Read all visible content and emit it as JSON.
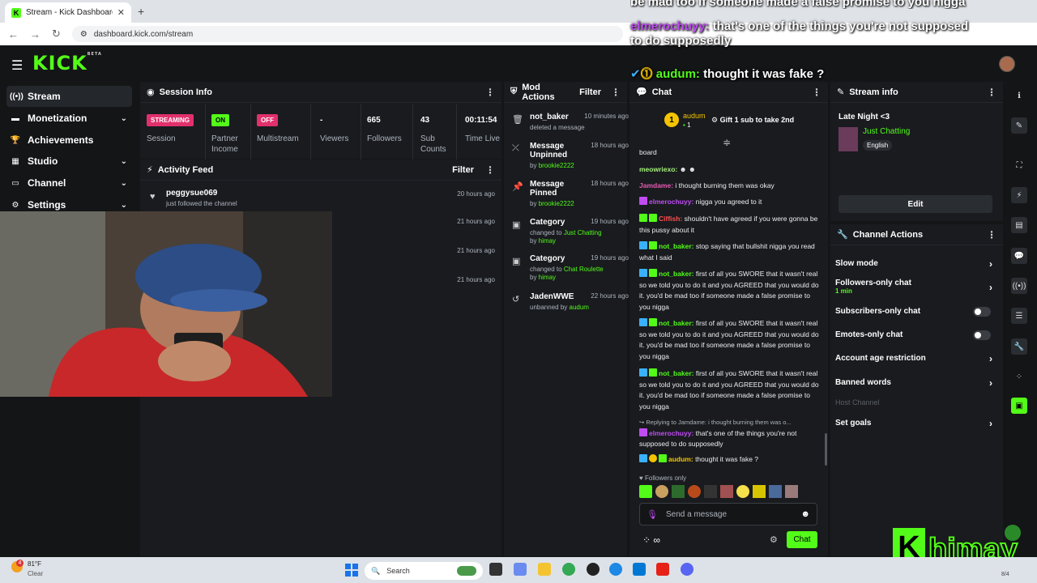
{
  "browser": {
    "tab_title": "Stream - Kick Dashboard",
    "url": "dashboard.kick.com/stream"
  },
  "overlay": {
    "top_text": "be mad too if someone made a false promise to you nigga",
    "msg1_user": "elmerochuyy:",
    "msg1_text": "that's one of the things you're not supposed",
    "msg1_text2": "to do supposedly",
    "msg2_user": "audum:",
    "msg2_text": "thought it was fake ?"
  },
  "app": {
    "logo": "KICK",
    "logo_sup": "BETA"
  },
  "sidebar": {
    "items": [
      {
        "label": "Stream",
        "icon": "stream-icon"
      },
      {
        "label": "Monetization",
        "icon": "money-icon"
      },
      {
        "label": "Achievements",
        "icon": "trophy-icon"
      },
      {
        "label": "Studio",
        "icon": "studio-icon"
      },
      {
        "label": "Channel",
        "icon": "channel-icon"
      },
      {
        "label": "Settings",
        "icon": "gear-icon"
      }
    ]
  },
  "session": {
    "title": "Session Info",
    "streaming": "STREAMING",
    "session_label": "Session",
    "on": "ON",
    "partner_label": "Partner Income",
    "off": "OFF",
    "multistream_label": "Multistream",
    "viewers": "-",
    "viewers_label": "Viewers",
    "followers": "665",
    "followers_label": "Followers",
    "subs": "43",
    "subs_label": "Sub Counts",
    "time": "00:11:54",
    "time_label": "Time Live"
  },
  "activity": {
    "title": "Activity Feed",
    "filter": "Filter",
    "rows": [
      {
        "user": "peggysue069",
        "text": "just followed the channel",
        "time": "20 hours ago"
      },
      {
        "time": "21 hours ago"
      },
      {
        "time": "21 hours ago"
      },
      {
        "time": "21 hours ago"
      }
    ]
  },
  "mod": {
    "title": "Mod Actions",
    "filter": "Filter",
    "rows": [
      {
        "head": "not_baker",
        "sub": "deleted a message",
        "by": "",
        "time": "10 minutes ago"
      },
      {
        "head": "Message Unpinned",
        "sub": "by",
        "by": "brookie2222",
        "time": "18 hours ago"
      },
      {
        "head": "Message Pinned",
        "sub": "by",
        "by": "brookie2222",
        "time": "18 hours ago"
      },
      {
        "head": "Category",
        "sub": "changed to",
        "cat": "Just Chatting",
        "by": "himay",
        "time": "19 hours ago"
      },
      {
        "head": "Category",
        "sub": "changed to",
        "cat": "Chat Roulette",
        "by": "himay",
        "time": "19 hours ago"
      },
      {
        "head": "JadenWWE",
        "sub": "unbanned by",
        "by": "audum",
        "time": "22 hours ago"
      }
    ]
  },
  "chat": {
    "title": "Chat",
    "pinned_user": "audum",
    "pinned_count": "1",
    "gift": "Gift 1 sub to take 2nd",
    "messages": [
      {
        "text": "board"
      },
      {
        "user": "meowriexo:",
        "text": " ☻ ☻"
      },
      {
        "user": "Jamdame:",
        "text": " i thought burning them was okay"
      },
      {
        "user": "elmerochuyy:",
        "text": " nigga you agreed to it"
      },
      {
        "user": "Ciffish:",
        "text": " shouldn't have agreed if you were gonna be this pussy about it"
      },
      {
        "user": "not_baker:",
        "text": " stop saying that bullshit nigga you read what I said"
      },
      {
        "user": "not_baker:",
        "text": " first of all you SWORE that it wasn't real so we told you to do it and you AGREED that you would do it. you'd be mad too if someone made a false promise to you nigga"
      },
      {
        "user": "not_baker:",
        "text": " first of all you SWORE that it wasn't real so we told you to do it and you AGREED that you would do it. you'd be mad too if someone made a false promise to you nigga"
      },
      {
        "user": "not_baker:",
        "text": " first of all you SWORE that it wasn't real so we told you to do it and you AGREED that you would do it. you'd be mad too if someone made a false promise to you nigga"
      },
      {
        "reply": "Replying to Jamdame: i thought burning them was o...",
        "user": "elmerochuyy:",
        "text": " that's one of the things you're not supposed to do supposedly"
      },
      {
        "user": "audum:",
        "text": " thought it was fake ?"
      }
    ],
    "followers_only": "Followers only",
    "placeholder": "Send a message",
    "send": "Chat"
  },
  "streaminfo": {
    "title": "Stream info",
    "stream_title": "Late Night <3",
    "category": "Just Chatting",
    "language": "English",
    "edit": "Edit"
  },
  "actions": {
    "title": "Channel Actions",
    "rows": [
      {
        "label": "Slow mode"
      },
      {
        "label": "Followers-only chat",
        "sub": "1 min"
      },
      {
        "label": "Subscribers-only chat"
      },
      {
        "label": "Emotes-only chat"
      },
      {
        "label": "Account age restriction"
      },
      {
        "label": "Banned words"
      },
      {
        "label": "Host Channel"
      },
      {
        "label": "Set goals"
      }
    ]
  },
  "watermark": {
    "text": "himay"
  },
  "taskbar": {
    "temp": "81°F",
    "weather": "Clear",
    "weather_badge": "4",
    "search": "Search",
    "date": "8/4"
  },
  "colors": {
    "accent": "#53fc18",
    "streaming": "#e1306c",
    "panel": "#191b1f",
    "bg": "#141517"
  }
}
